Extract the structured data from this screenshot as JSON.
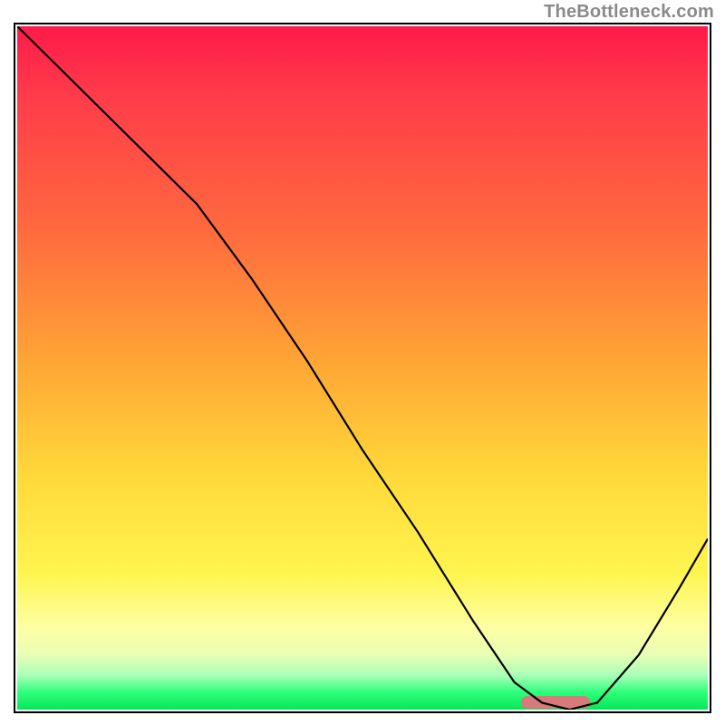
{
  "watermark": "TheBottleneck.com",
  "chart_data": {
    "type": "line",
    "title": "",
    "xlabel": "",
    "ylabel": "",
    "xlim": [
      0,
      100
    ],
    "ylim": [
      0,
      100
    ],
    "legend": false,
    "grid": false,
    "background": "red-to-green vertical gradient",
    "series": [
      {
        "name": "bottleneck-curve",
        "x": [
          0,
          10,
          20,
          26,
          34,
          42,
          50,
          58,
          66,
          72,
          76,
          80,
          84,
          90,
          96,
          100
        ],
        "y": [
          100,
          90,
          80,
          74,
          63,
          51,
          38,
          26,
          13,
          4,
          1,
          0,
          1,
          8,
          18,
          25
        ]
      }
    ],
    "marker": {
      "name": "highlight-range",
      "x_start": 73,
      "x_end": 83,
      "y": 1,
      "color": "#d97a7a"
    },
    "gradient_stops": [
      {
        "pos": 0.0,
        "color": "#ff1a4a"
      },
      {
        "pos": 0.3,
        "color": "#ff6a3e"
      },
      {
        "pos": 0.66,
        "color": "#ffd93a"
      },
      {
        "pos": 0.88,
        "color": "#fdffa3"
      },
      {
        "pos": 0.97,
        "color": "#2eff7a"
      },
      {
        "pos": 1.0,
        "color": "#06e65a"
      }
    ]
  }
}
